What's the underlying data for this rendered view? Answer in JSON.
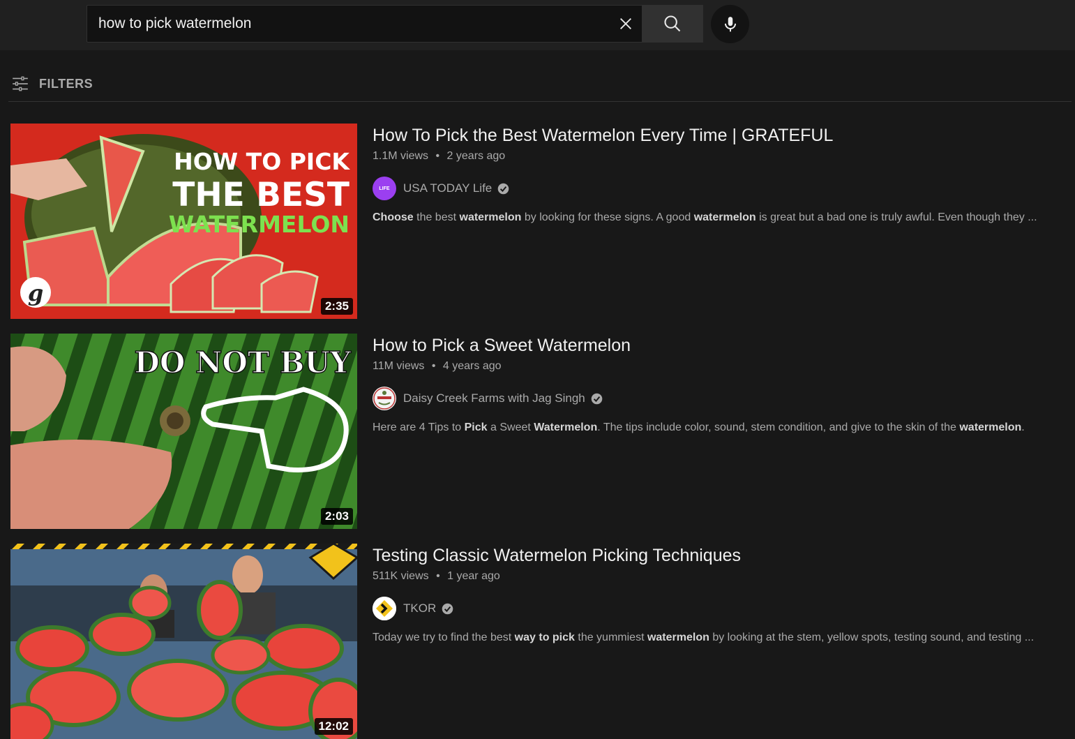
{
  "search": {
    "query": "how to pick watermelon"
  },
  "filters": {
    "label": "FILTERS"
  },
  "results": [
    {
      "title": "How To Pick the Best Watermelon Every Time | GRATEFUL",
      "views": "1.1M views",
      "age": "2 years ago",
      "channel": "USA TODAY Life",
      "avatar_text": "LIFE",
      "duration": "2:35",
      "thumb_text": [
        "HOW TO PICK",
        "THE BEST",
        "WATERMELON"
      ],
      "desc": [
        {
          "t": "Choose",
          "b": true
        },
        {
          "t": " the best ",
          "b": false
        },
        {
          "t": "watermelon",
          "b": true
        },
        {
          "t": " by looking for these signs. A good ",
          "b": false
        },
        {
          "t": "watermelon",
          "b": true
        },
        {
          "t": " is great but a bad one is truly awful. Even though they ...",
          "b": false
        }
      ]
    },
    {
      "title": "How to Pick a Sweet Watermelon",
      "views": "11M views",
      "age": "4 years ago",
      "channel": "Daisy Creek Farms with Jag Singh",
      "duration": "2:03",
      "thumb_text": [
        "DO NOT BUY"
      ],
      "desc": [
        {
          "t": "Here are 4 Tips to ",
          "b": false
        },
        {
          "t": "Pick",
          "b": true
        },
        {
          "t": " a Sweet ",
          "b": false
        },
        {
          "t": "Watermelon",
          "b": true
        },
        {
          "t": ". The tips include color, sound, stem condition, and give to the skin of the ",
          "b": false
        },
        {
          "t": "watermelon",
          "b": true
        },
        {
          "t": ".",
          "b": false
        }
      ]
    },
    {
      "title": "Testing Classic Watermelon Picking Techniques",
      "views": "511K views",
      "age": "1 year ago",
      "channel": "TKOR",
      "duration": "12:02",
      "desc": [
        {
          "t": "Today we try to find the best ",
          "b": false
        },
        {
          "t": "way to pick",
          "b": true
        },
        {
          "t": " the yummiest ",
          "b": false
        },
        {
          "t": "watermelon",
          "b": true
        },
        {
          "t": " by looking at the stem, yellow spots, testing sound, and testing ...",
          "b": false
        }
      ]
    }
  ],
  "meta_separator": "•",
  "icons": {
    "clear": "close-icon",
    "search": "search-icon",
    "mic": "mic-icon",
    "filters": "sliders-icon",
    "verified": "check-circle-icon"
  },
  "colors": {
    "background": "#181818",
    "topbar": "#202020",
    "text_primary": "#f1f1f1",
    "text_secondary": "#aaaaaa",
    "usa_today_purple": "#9b3ff0"
  }
}
